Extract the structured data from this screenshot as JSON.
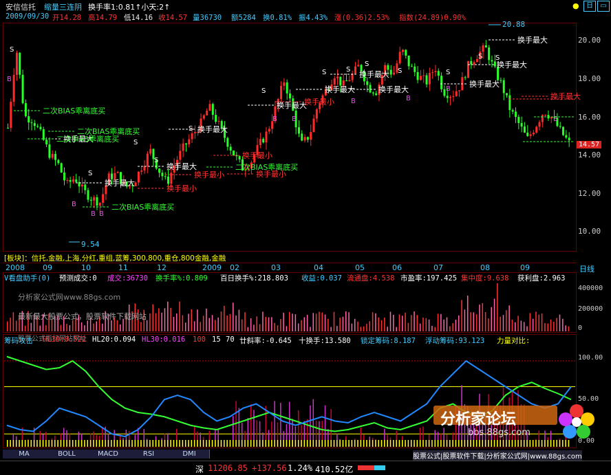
{
  "title_bar": {
    "stock_name": "安信信托",
    "indicator": "缩量三连阴",
    "turnover_ratio": "换手率1:0.81↑小天:2↑"
  },
  "info_bar": {
    "date": "2009/09/30",
    "open": "开14.28",
    "high": "高14.79",
    "low": "低14.16",
    "close": "收14.57",
    "volume": "量36730",
    "amount": "额5284",
    "turnover": "换0.81%",
    "amplitude": "振4.43%",
    "change": "涨(0.36)2.53%",
    "index": "指数(24.89)0.90%"
  },
  "price_axis": [
    "20.00",
    "18.00",
    "16.00",
    "14.00",
    "12.00",
    "10.00"
  ],
  "current_price": "14.57",
  "price_labels": {
    "high": "20.88",
    "low": "9.54"
  },
  "annotations": {
    "max_turnover": "换手最大",
    "min_turnover": "换手最小",
    "bias_buy": "二次BIAS乖离底买",
    "s": "S",
    "b": "B"
  },
  "block_info": "[板块]：信托,金融,上海,分红,重组,蓝筹,300,800,重仓,800金融,金融",
  "time_axis": [
    "2008",
    "09",
    "10",
    "11",
    "12",
    "2009",
    "02",
    "03",
    "04",
    "05",
    "06",
    "07",
    "08",
    "09"
  ],
  "time_axis_right": "日线",
  "volume_bar": {
    "title": "V看盘助手(0)",
    "forecast": "预测成交:0",
    "volume": "成交:36730",
    "turnover": "换手率%:0.809",
    "turnover100": "百日换手%:218.803",
    "profit": "收益:0.037",
    "float": "流通盘:4.538",
    "pe": "市盈率:197.425",
    "concentration": "集中度:9.638",
    "profit_disk": "获利盘:2.963"
  },
  "volume_axis": [
    "400000",
    "200000",
    "0"
  ],
  "watermark": {
    "site": "分析家公式网www.88gs.com",
    "slogan": "最新最大股票公式，股票软件下载网站",
    "slogan2": "股票公式指标网站网址"
  },
  "chip_bar": {
    "title": "筹码攻击",
    "hl10": "HL10:0.522",
    "hl20": "HL20:0.094",
    "hl30": "HL30:0.016",
    "v100": "100",
    "v15": "15",
    "v70": "70",
    "slope": "廿斜率:-0.645",
    "ten_turn": "十换手:13.580",
    "locked": "锁定筹码:8.187",
    "floating": "浮动筹码:93.123",
    "power": "力量对比:"
  },
  "chip_axis": [
    "100.00",
    "50.00",
    "0.00"
  ],
  "tabs": [
    "MA",
    "BOLL",
    "MACD",
    "RSI",
    "DMI"
  ],
  "logo": {
    "name": "分析家论坛",
    "url": "bbs.88gs.com",
    "footer": "股票公式|股票软件下载|分析家公式网|www.88gs.com"
  },
  "status": {
    "market": "深",
    "index": "11206.85",
    "change": "+137.56",
    "pct": "1.24%",
    "amount": "410.52亿"
  },
  "colors": {
    "up": "#ff3333",
    "down": "#33ff33",
    "accent": "#00ffff",
    "yellow": "#ffff00",
    "magenta": "#ff44ff"
  }
}
